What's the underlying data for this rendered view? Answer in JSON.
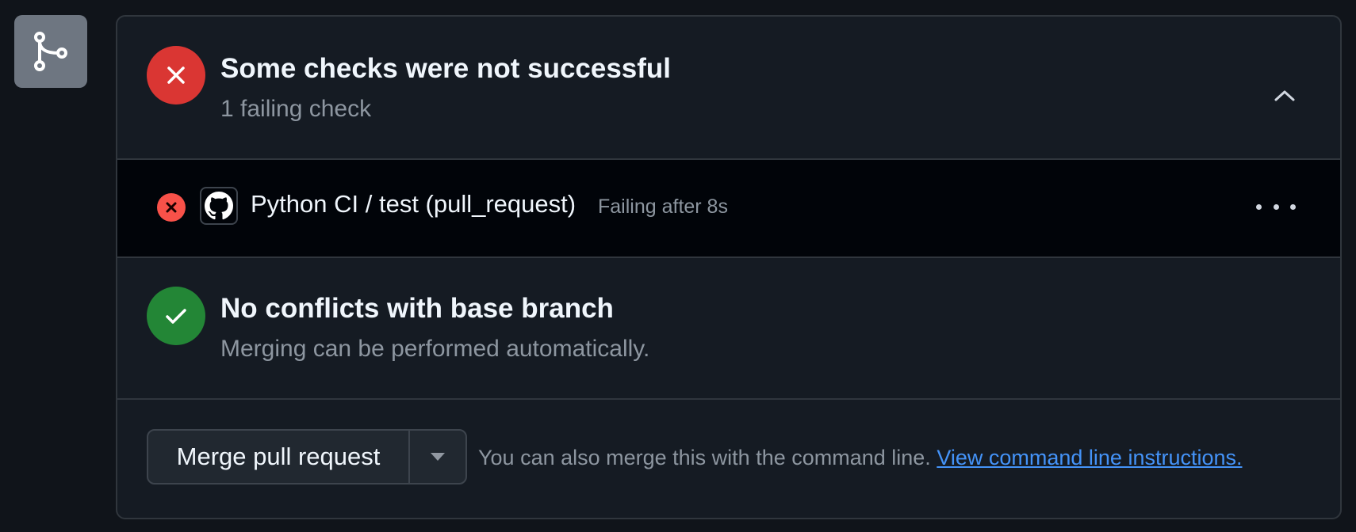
{
  "checks_section": {
    "title": "Some checks were not successful",
    "subtitle": "1 failing check"
  },
  "check_row": {
    "name": "Python CI / test (pull_request)",
    "status": "Failing after 8s"
  },
  "conflicts_section": {
    "title": "No conflicts with base branch",
    "subtitle": "Merging can be performed automatically."
  },
  "merge": {
    "button_label": "Merge pull request",
    "hint_text": "You can also merge this with the command line.",
    "link_text": "View command line instructions."
  },
  "colors": {
    "fail": "#da3633",
    "success": "#238636",
    "link": "#4493f8"
  },
  "icons": [
    "git-merge-icon",
    "x-circle-icon",
    "chevron-up-icon",
    "github-mark-icon",
    "kebab-horizontal-icon",
    "check-circle-icon",
    "triangle-down-icon"
  ]
}
